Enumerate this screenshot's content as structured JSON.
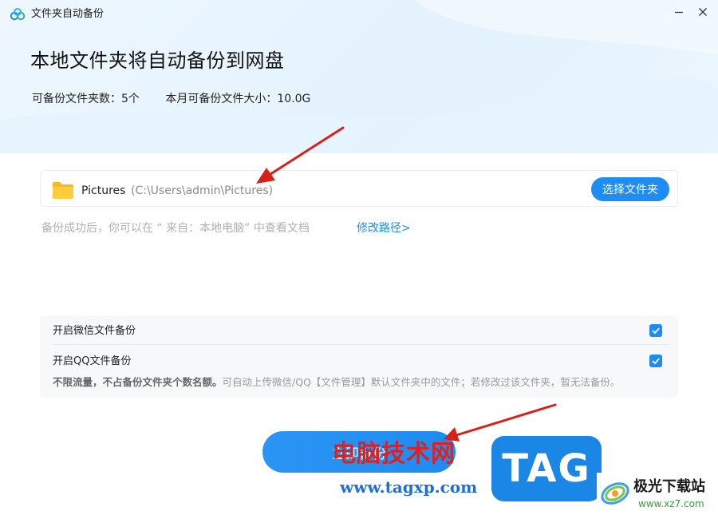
{
  "window": {
    "title": "文件夹自动备份",
    "minimize_icon": "minimize-icon",
    "close_icon": "close-icon"
  },
  "header": {
    "heading": "本地文件夹将自动备份到网盘",
    "stats_folders": "可备份文件夹数：5个",
    "stats_size": "本月可备份文件大小：10.0G"
  },
  "folder": {
    "icon": "folder-icon",
    "name": "Pictures",
    "path": "(C:\\Users\\admin\\Pictures)",
    "choose_label": "选择文件夹"
  },
  "hint": {
    "text": "备份成功后，你可以在 “ 来自：本地电脑” 中查看文档",
    "modify_label": "修改路径>"
  },
  "options": {
    "wechat_label": "开启微信文件备份",
    "wechat_checked": true,
    "qq_label": "开启QQ文件备份",
    "qq_checked": true,
    "note_strong": "不限流量，不占备份文件夹个数名额。",
    "note_text": "可自动上传微信/QQ【文件管理】默认文件夹中的文件；若修改过该文件夹，暂无法备份。"
  },
  "primary_button": {
    "label": "立即备份"
  },
  "watermarks": {
    "cn_text": "电脑技术网",
    "url": "www.tagxp.com",
    "tag": "TAG",
    "site_name": "极光下载站",
    "site_url": "www.xz7.com"
  },
  "colors": {
    "accent": "#1e8cf0",
    "arrow": "#d8201a"
  }
}
